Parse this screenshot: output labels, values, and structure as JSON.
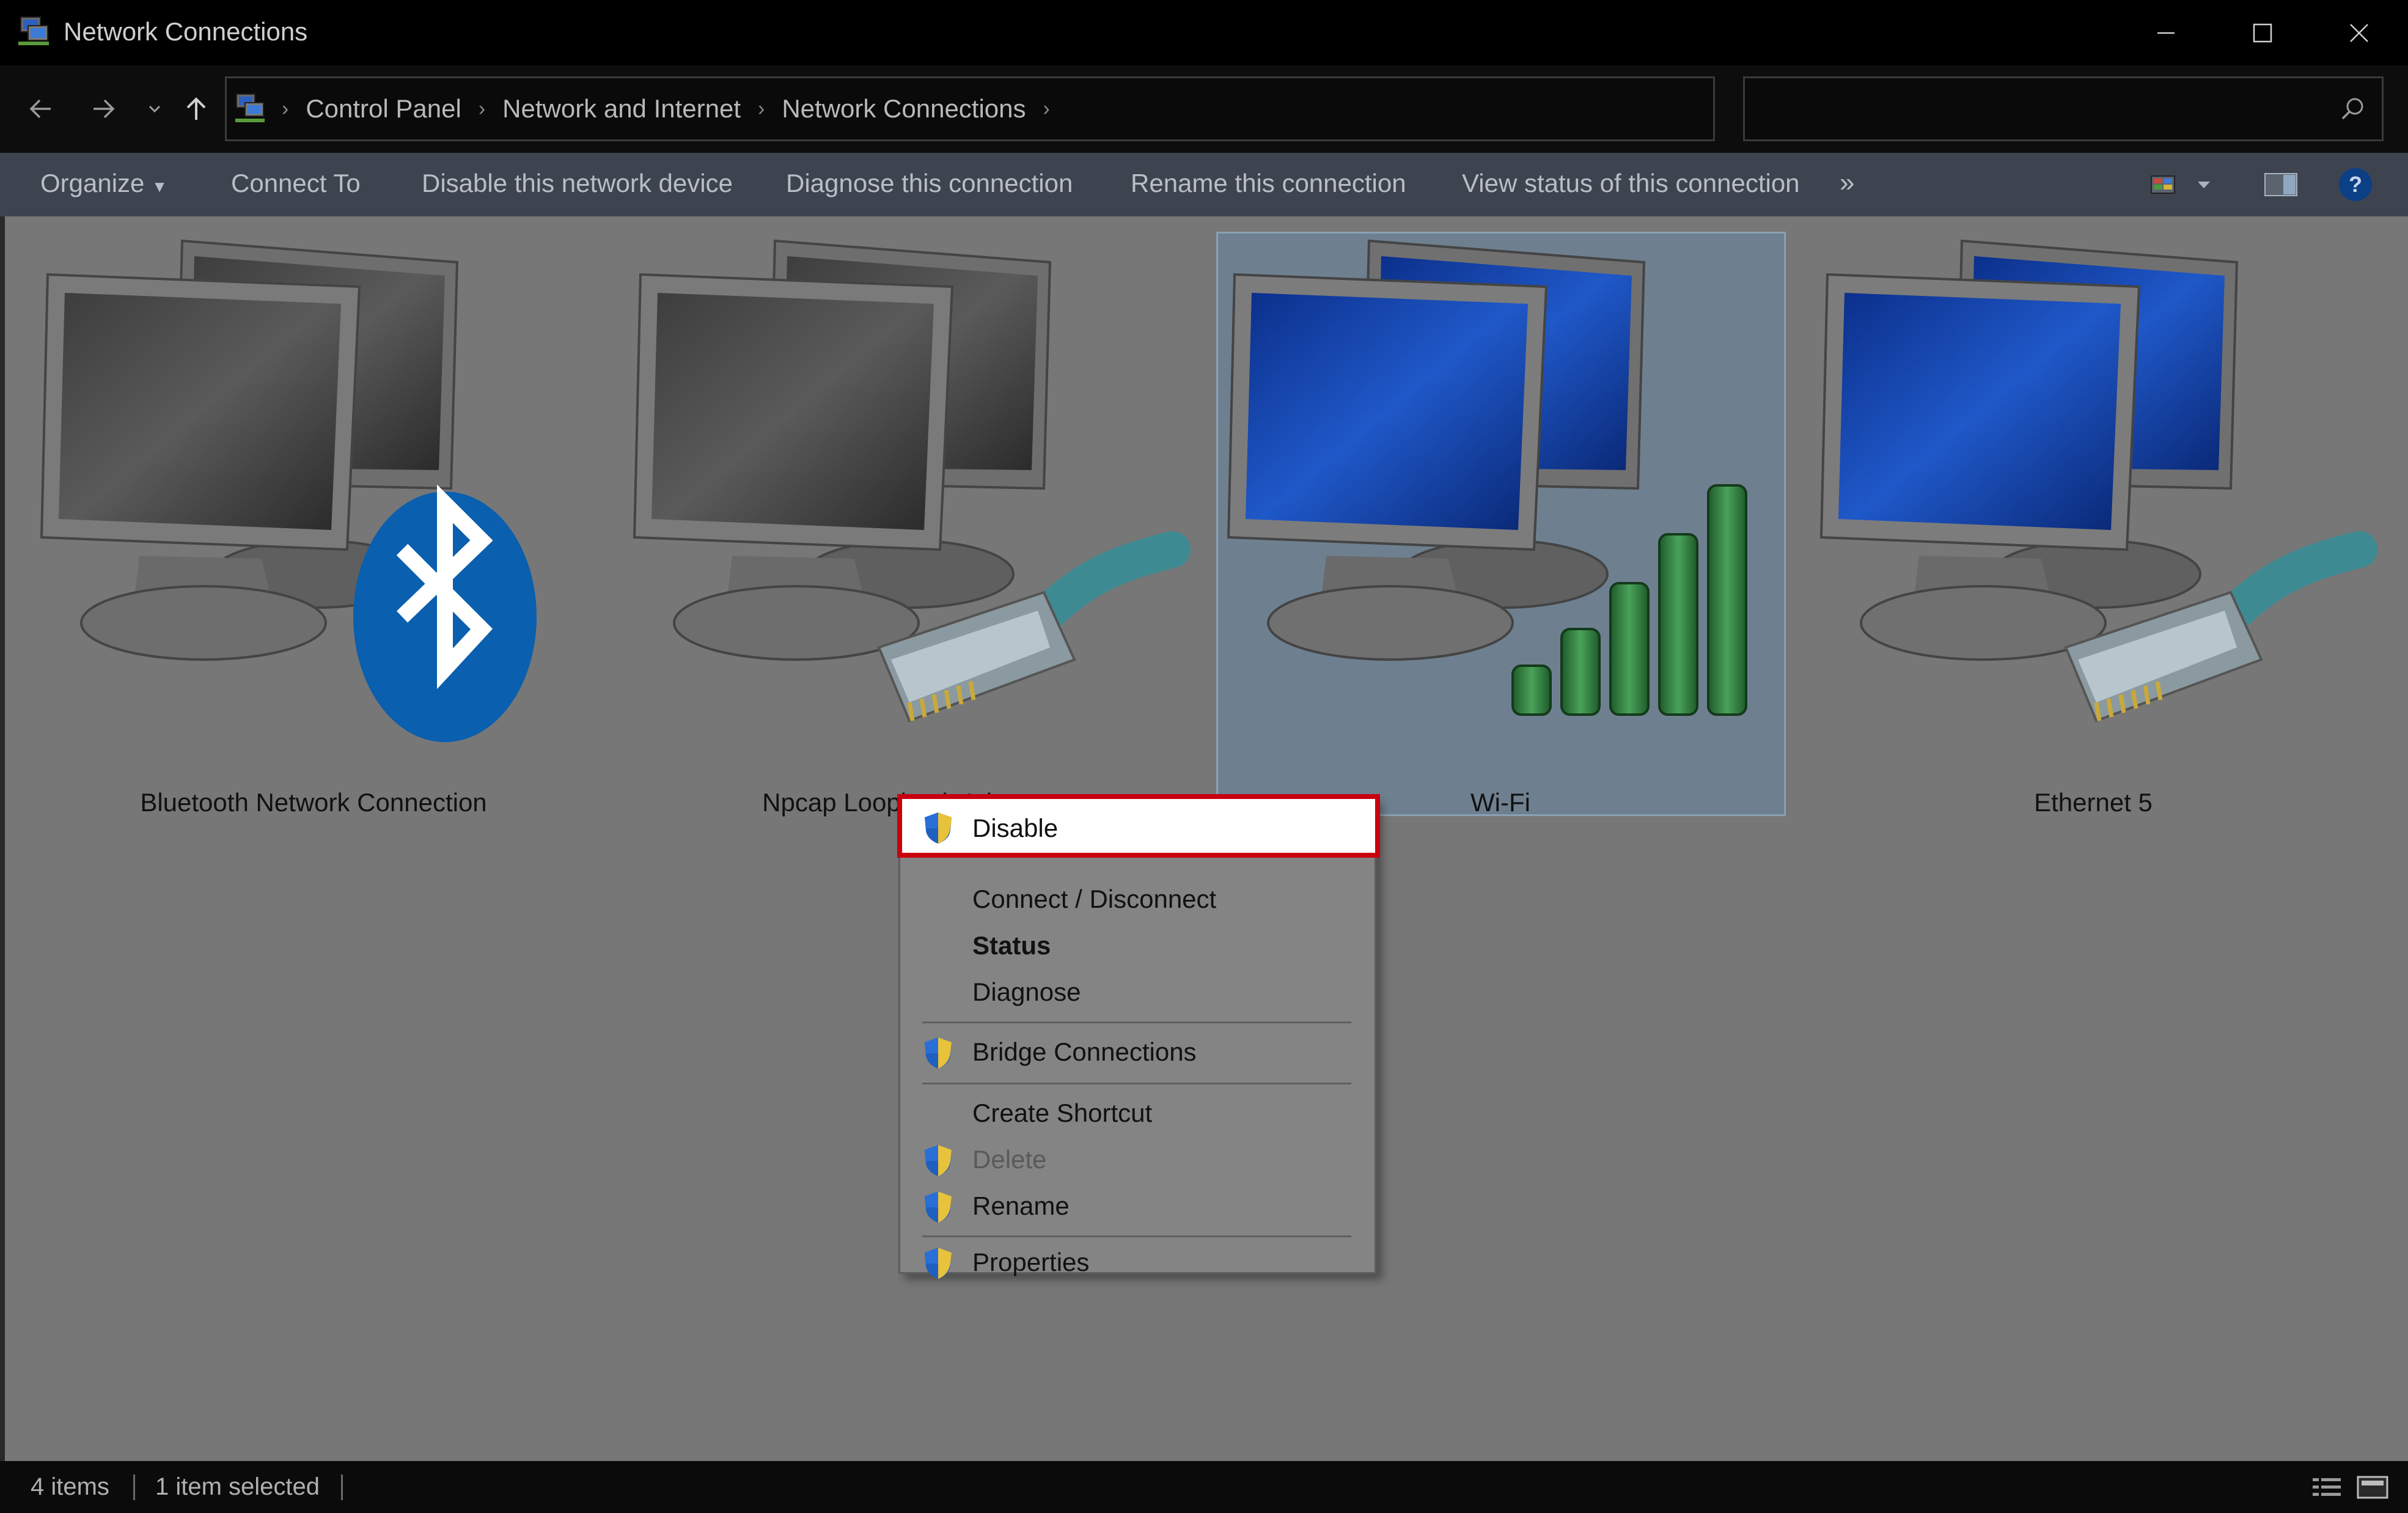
{
  "window": {
    "title": "Network Connections",
    "app_icon": "network-connections-icon"
  },
  "address": {
    "breadcrumbs": [
      "Control Panel",
      "Network and Internet",
      "Network Connections"
    ],
    "search_placeholder": ""
  },
  "toolbar": {
    "organize": "Organize",
    "items": [
      "Connect To",
      "Disable this network device",
      "Diagnose this connection",
      "Rename this connection",
      "View status of this connection"
    ],
    "more": "»"
  },
  "connections": [
    {
      "name": "Bluetooth Network Connection",
      "type": "bluetooth",
      "state": "disabled"
    },
    {
      "name": "Npcap Loopback Adapter",
      "type": "ethernet",
      "state": "disabled"
    },
    {
      "name": "Wi-Fi",
      "type": "wifi",
      "state": "connected",
      "selected": true
    },
    {
      "name": "Ethernet 5",
      "type": "ethernet",
      "state": "connected"
    }
  ],
  "context_menu": {
    "items": [
      {
        "label": "Disable",
        "shield": true,
        "highlighted": true
      },
      {
        "label": "Connect / Disconnect"
      },
      {
        "label": "Status",
        "bold": true
      },
      {
        "label": "Diagnose"
      },
      {
        "label": "Bridge Connections",
        "shield": true
      },
      {
        "label": "Create Shortcut"
      },
      {
        "label": "Delete",
        "shield": true,
        "disabled": true
      },
      {
        "label": "Rename",
        "shield": true
      },
      {
        "label": "Properties",
        "shield": true
      }
    ]
  },
  "status": {
    "items": "4 items",
    "selected": "1 item selected"
  },
  "colors": {
    "highlight_border": "#c9000d",
    "accent": "#1a5fb4",
    "bluetooth_blue": "#0a6fc2",
    "signal_green": "#2d8a3e"
  }
}
